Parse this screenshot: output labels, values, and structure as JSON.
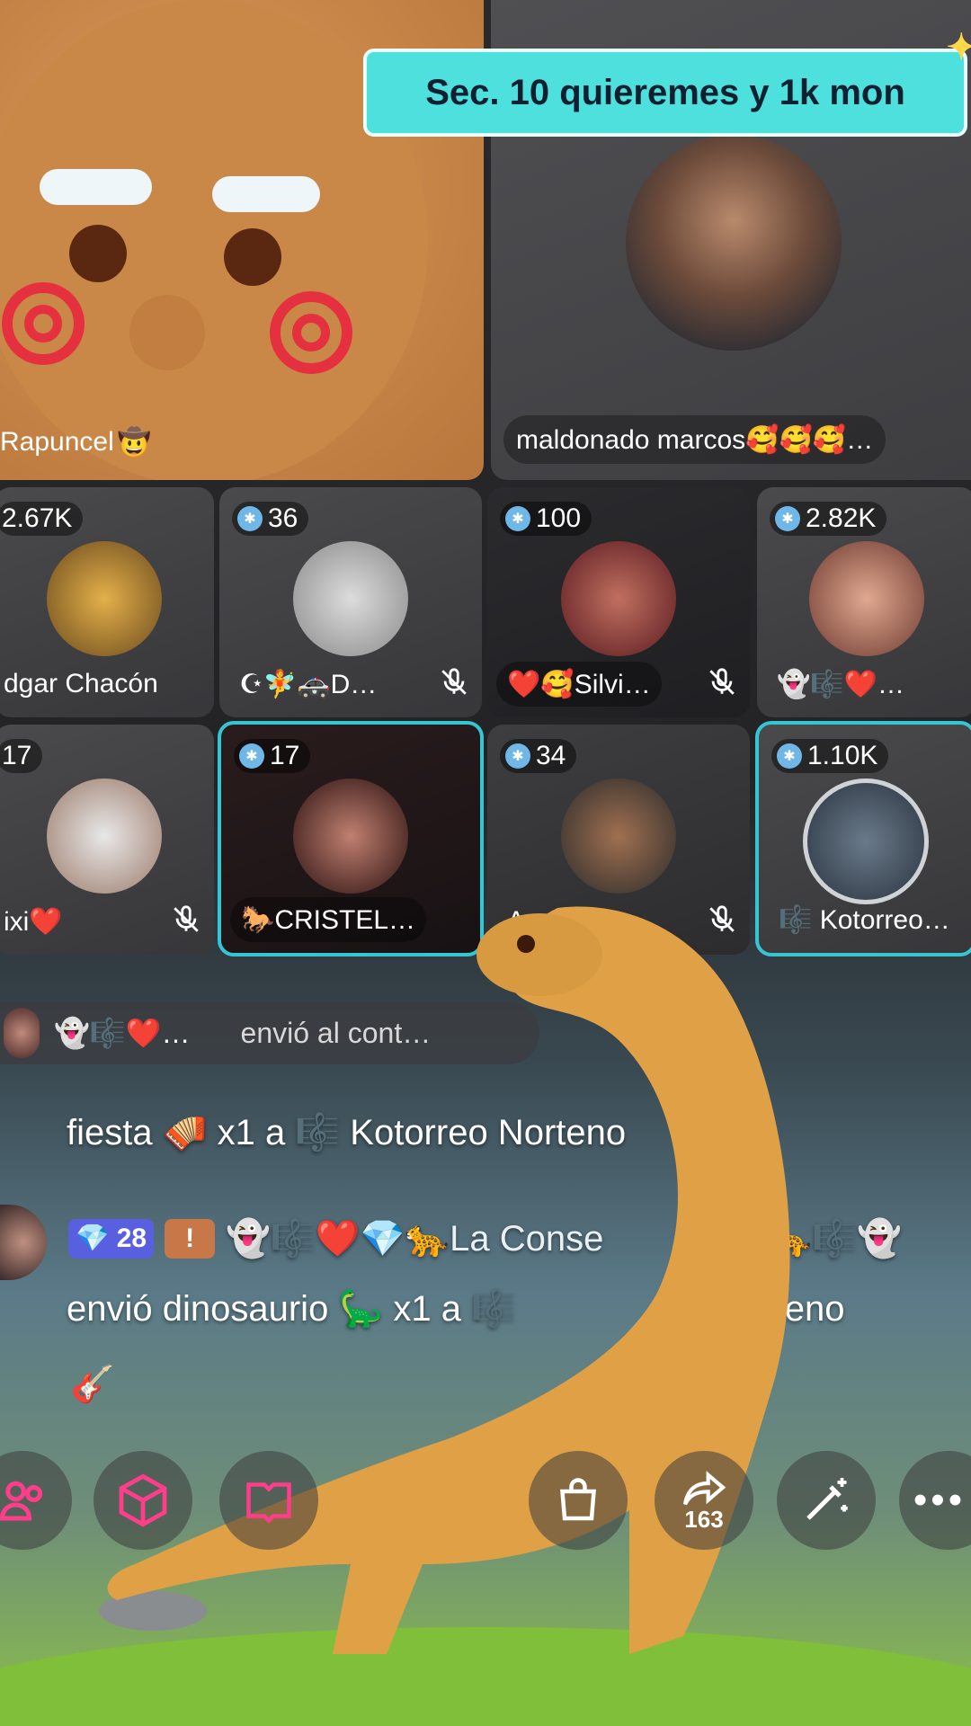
{
  "banner": {
    "text": "Sec. 10 quieremes y 1k mon"
  },
  "top_tiles": {
    "left": {
      "name": "Rapuncel",
      "name_suffix": "🤠"
    },
    "right": {
      "name": "maldonado marcos🥰🥰🥰…"
    }
  },
  "tiles": [
    {
      "count": "2.67K",
      "name": "dgar Chacón",
      "muted": false
    },
    {
      "count": "36",
      "name": "☪🧚🚓D…",
      "muted": true
    },
    {
      "count": "100",
      "name": "❤️🥰Silvi…",
      "muted": true
    },
    {
      "count": "2.82K",
      "name": "👻🎼❤️…",
      "muted": false
    },
    {
      "count": "17",
      "name": "ixi❤️",
      "muted": true
    },
    {
      "count": "17",
      "name": "🐎CRISTEL…",
      "muted": false
    },
    {
      "count": "34",
      "name": "Arr…H",
      "muted": true
    },
    {
      "count": "1.10K",
      "name": "🎼 Kotorreo…",
      "muted": false
    }
  ],
  "gift_bar": {
    "user": "👻🎼❤️…",
    "text": "envió al cont…"
  },
  "chat": {
    "line1": "fiesta 🪗 x1 a 🎼 Kotorreo Norteno",
    "line2_badge_level": "28",
    "line2_user": "👻🎼❤️💎🐆La Conse",
    "line2_tail": "🐆🎼👻",
    "line3": "envió dinosaurio 🦕 x1 a 🎼",
    "line3_tail": "o Norteno"
  },
  "toolbar": {
    "share_count": "163"
  },
  "colors": {
    "accent": "#35c6d3",
    "banner": "#4ee0dd"
  }
}
